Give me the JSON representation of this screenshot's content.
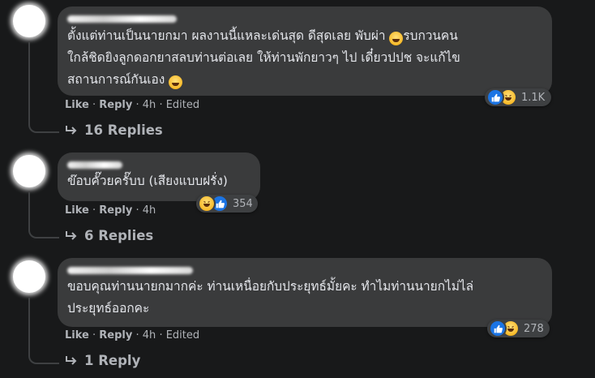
{
  "comments": [
    {
      "author": "",
      "text_lines": [
        "ตั้งแต่ท่านเป็นนายกมา ผลงานนี้แหละเด่นสุด ดีสุดเลย พับผ่า",
        "รบกวนคน",
        "ใกล้ชิดยิงลูกดอกยาสลบท่านต่อเลย ให้ท่านพักยาวๆ ไป เดี๋ยวปปช จะแก้ไข",
        "สถานการณ์กันเอง"
      ],
      "actions": {
        "like": "Like",
        "reply": "Reply",
        "sep": "·",
        "time": "4h",
        "edited": "Edited"
      },
      "reactions": {
        "types": [
          "like-icon",
          "haha-icon"
        ],
        "count": "1.1K"
      },
      "replies_label": "16 Replies"
    },
    {
      "author": "",
      "text_lines": [
        "ข๊อบคั๊วยครั๊บบ (เสียงแบบฝรั่ง)"
      ],
      "actions": {
        "like": "Like",
        "reply": "Reply",
        "sep": "·",
        "time": "4h"
      },
      "reactions": {
        "types": [
          "haha-icon",
          "like-icon"
        ],
        "count": "354"
      },
      "replies_label": "6 Replies"
    },
    {
      "author": "",
      "text_lines": [
        "ขอบคุณท่านนายกมากค่ะ ท่านเหนื่อยกับประยุทธ์มั้ยคะ ทำไมท่านนายกไม่ไล่",
        "ประยุทธ์ออกคะ"
      ],
      "actions": {
        "like": "Like",
        "reply": "Reply",
        "sep": "·",
        "time": "4h",
        "edited": "Edited"
      },
      "reactions": {
        "types": [
          "like-icon",
          "haha-icon"
        ],
        "count": "278"
      },
      "replies_label": "1 Reply"
    }
  ],
  "colors": {
    "background": "#18191a",
    "bubble": "#3a3b3c",
    "text": "#e4e6eb",
    "meta": "#b0b3b8",
    "like_blue": "#1b74e4",
    "haha_yellow": "#f7b928"
  }
}
